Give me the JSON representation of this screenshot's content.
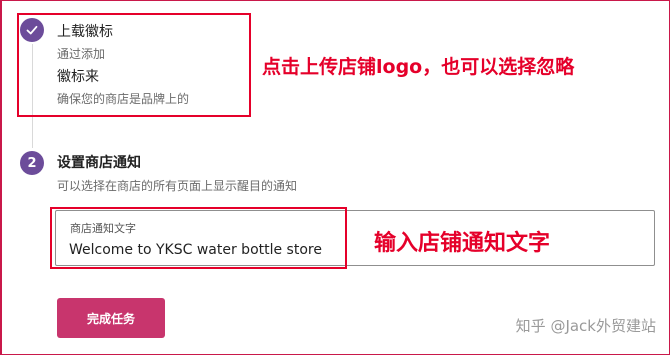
{
  "step1": {
    "title": "上载徽标",
    "subtitle_line1": "通过添加",
    "title_line2": "徽标来",
    "subtitle_line2": "确保您的商店是品牌上的"
  },
  "step2": {
    "number": "2",
    "title": "设置商店通知",
    "subtitle": "可以选择在商店的所有页面上显示醒目的通知"
  },
  "notice_field": {
    "label": "商店通知文字",
    "value": "Welcome to YKSC water bottle store"
  },
  "finish_button": {
    "label": "完成任务"
  },
  "annotations": {
    "logo_hint": "点击上传店铺logo，也可以选择忽略",
    "notice_hint": "输入店铺通知文字"
  },
  "watermark": "知乎 @Jack外贸建站",
  "colors": {
    "step_icon": "#6c4c9a",
    "button": "#c8356d",
    "annotation": "#e5002a"
  }
}
